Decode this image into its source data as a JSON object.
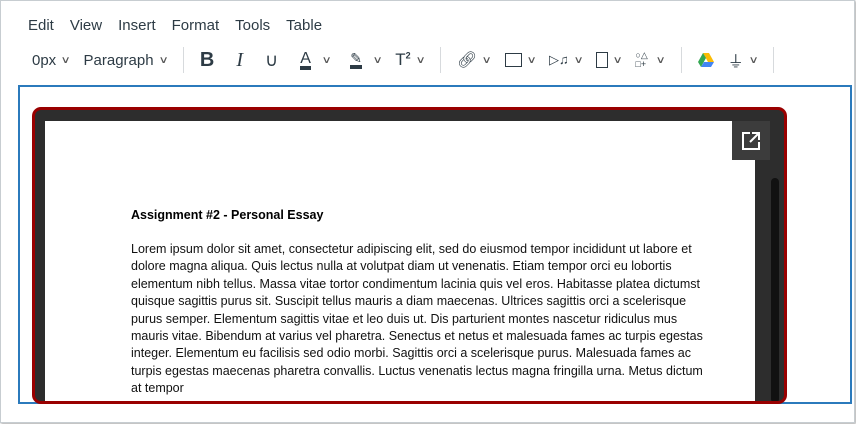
{
  "menu": [
    "Edit",
    "View",
    "Insert",
    "Format",
    "Tools",
    "Table"
  ],
  "toolbar": {
    "font_size": "0px",
    "block_format": "Paragraph",
    "superscript_label": "2"
  },
  "document": {
    "title": "Assignment #2 - Personal Essay",
    "body": "Lorem ipsum dolor sit amet, consectetur adipiscing elit, sed do eiusmod tempor incididunt ut labore et dolore magna aliqua. Quis lectus nulla at volutpat diam ut venenatis. Etiam tempor orci eu lobortis elementum nibh tellus. Massa vitae tortor condimentum lacinia quis vel eros. Habitasse platea dictumst quisque sagittis purus sit. Suscipit tellus mauris a diam maecenas. Ultrices sagittis orci a scelerisque purus semper. Elementum sagittis vitae et leo duis ut. Dis parturient montes nascetur ridiculus mus mauris vitae. Bibendum at varius vel pharetra. Senectus et netus et malesuada fames ac turpis egestas integer. Elementum eu facilisis sed odio morbi. Sagittis orci a scelerisque purus. Malesuada fames ac turpis egestas maecenas pharetra convallis. Luctus venenatis lectus magna fringilla urna. Metus dictum at tempor"
  },
  "colors": {
    "accent": "#2b7abc",
    "frame": "#990000"
  }
}
